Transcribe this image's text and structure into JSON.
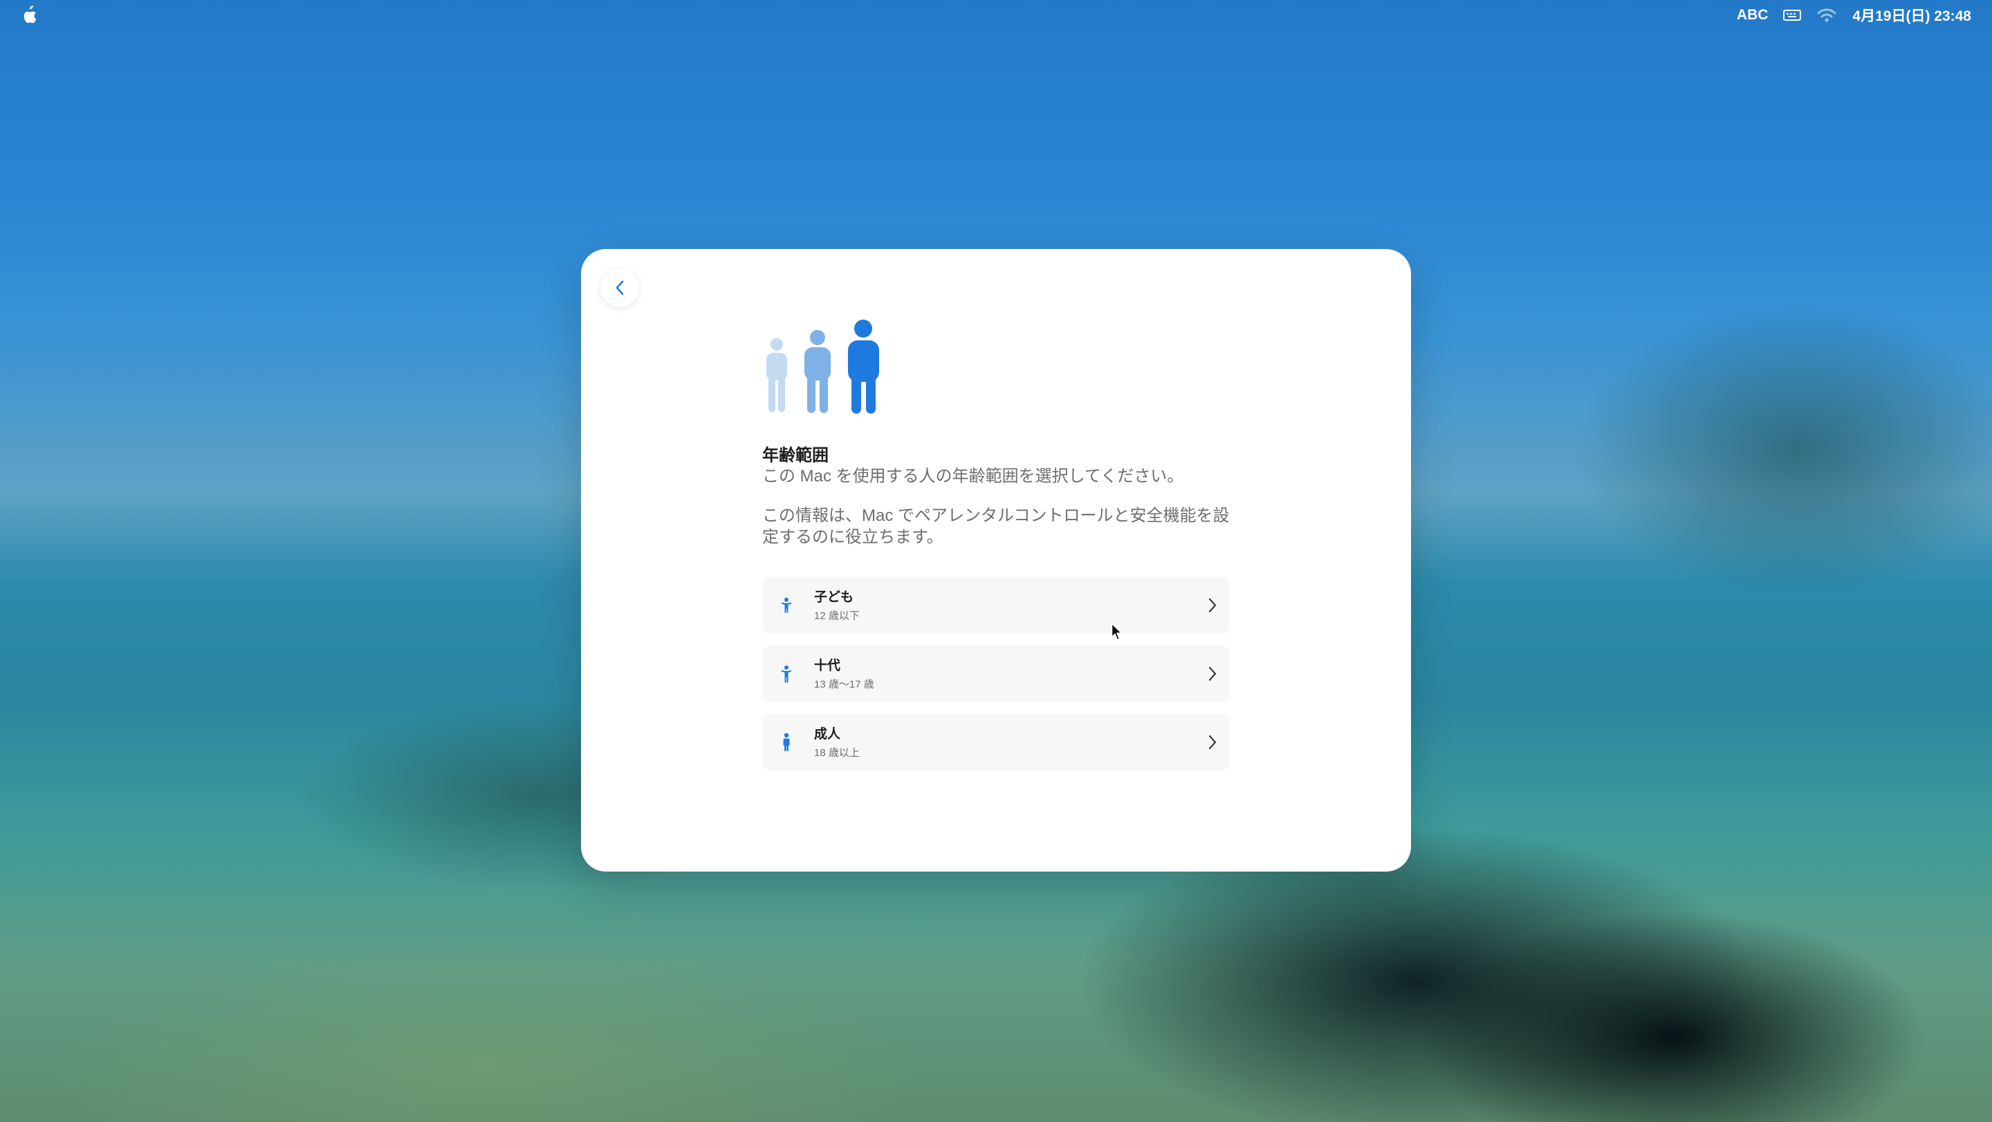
{
  "menubar": {
    "apple_icon": "apple-logo-icon",
    "input_source": "ABC",
    "keyboard_icon": "keyboard-icon",
    "wifi_icon": "wifi-icon",
    "datetime": "4月19日(日)  23:48"
  },
  "dialog": {
    "back_icon": "chevron-left-icon",
    "hero_icon": "people-age-range-icon",
    "title": "年齢範囲",
    "subtitle": "この Mac を使用する人の年齢範囲を選択してください。",
    "description": "この情報は、Mac でペアレンタルコントロールと安全機能を設定するのに役立ちます。",
    "options": [
      {
        "label": "子ども",
        "detail": "12 歳以下",
        "icon": "child-figure-icon"
      },
      {
        "label": "十代",
        "detail": "13 歳〜17 歳",
        "icon": "teen-figure-icon"
      },
      {
        "label": "成人",
        "detail": "18 歳以上",
        "icon": "adult-figure-icon"
      }
    ]
  },
  "colors": {
    "accent": "#1f7ae0",
    "accent_light": "#7fb0e6",
    "accent_pale": "#c4daf3",
    "text_primary": "#1d1d1f",
    "text_secondary": "#6e6e73"
  }
}
